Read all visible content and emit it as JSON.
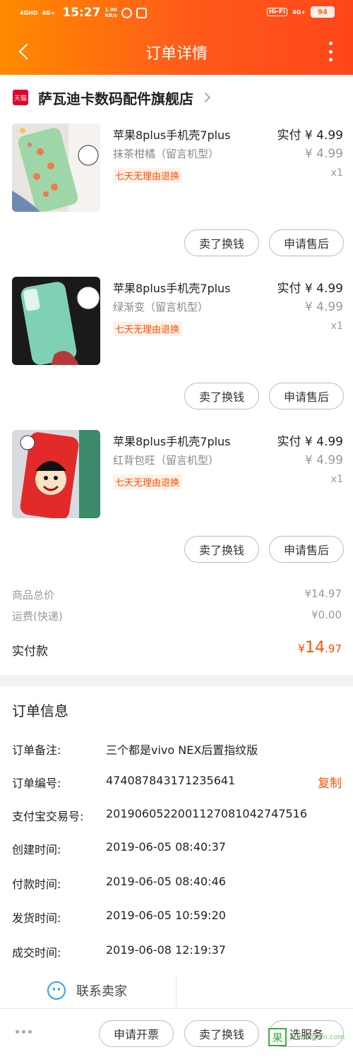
{
  "status_bar": {
    "net1": "4GHD",
    "net2": "4G+",
    "time": "15:27",
    "speed_value": "1.90",
    "speed_unit": "KB/s",
    "hifi": "Hi-Fi",
    "net3": "4G+",
    "battery": "94"
  },
  "nav": {
    "title": "订单详情"
  },
  "store": {
    "badge": "天猫",
    "name": "萨瓦迪卡数码配件旗舰店"
  },
  "items": [
    {
      "title": "苹果8plus手机壳7plus",
      "variant": "抹茶柑橘（留言机型）",
      "badge": "七天无理由退换",
      "paid": "实付 ¥ 4.99",
      "orig": "¥ 4.99",
      "qty": "x1",
      "btn_sell": "卖了换钱",
      "btn_service": "申请售后"
    },
    {
      "title": "苹果8plus手机壳7plus",
      "variant": "绿渐变（留言机型）",
      "badge": "七天无理由退换",
      "paid": "实付 ¥ 4.99",
      "orig": "¥ 4.99",
      "qty": "x1",
      "btn_sell": "卖了换钱",
      "btn_service": "申请售后"
    },
    {
      "title": "苹果8plus手机壳7plus",
      "variant": "红背包旺（留言机型）",
      "badge": "七天无理由退换",
      "paid": "实付 ¥ 4.99",
      "orig": "¥ 4.99",
      "qty": "x1",
      "btn_sell": "卖了换钱",
      "btn_service": "申请售后"
    }
  ],
  "summary": {
    "goods_label": "商品总价",
    "goods_value": "¥14.97",
    "shipping_label": "运费(快递)",
    "shipping_value": "¥0.00",
    "total_label": "实付款",
    "total_currency": "¥",
    "total_int": "14",
    "total_dec": ".97"
  },
  "order_info": {
    "title": "订单信息",
    "rows": [
      {
        "label": "订单备注:",
        "value": "三个都是vivo NEX后置指纹版"
      },
      {
        "label": "订单编号:",
        "value": "474087843171235641",
        "action": "复制"
      },
      {
        "label": "支付宝交易号:",
        "value": "2019060522001127081042747516"
      },
      {
        "label": "创建时间:",
        "value": "2019-06-05 08:40:37"
      },
      {
        "label": "付款时间:",
        "value": "2019-06-05 08:40:46"
      },
      {
        "label": "发货时间:",
        "value": "2019-06-05 10:59:20"
      },
      {
        "label": "成交时间:",
        "value": "2019-06-08 12:19:37"
      }
    ]
  },
  "contact": {
    "label": "联系卖家"
  },
  "bottom_bar": {
    "invoice": "申请开票",
    "sell": "卖了换钱",
    "service": "选服务"
  },
  "watermark": {
    "logo": "果",
    "text": "JiChengXin.com"
  },
  "colors": {
    "accent": "#ff5000",
    "header_start": "#ff8a00",
    "header_end": "#ff4619",
    "tmall": "#e4002b",
    "contact_icon": "#2aa4f4"
  }
}
